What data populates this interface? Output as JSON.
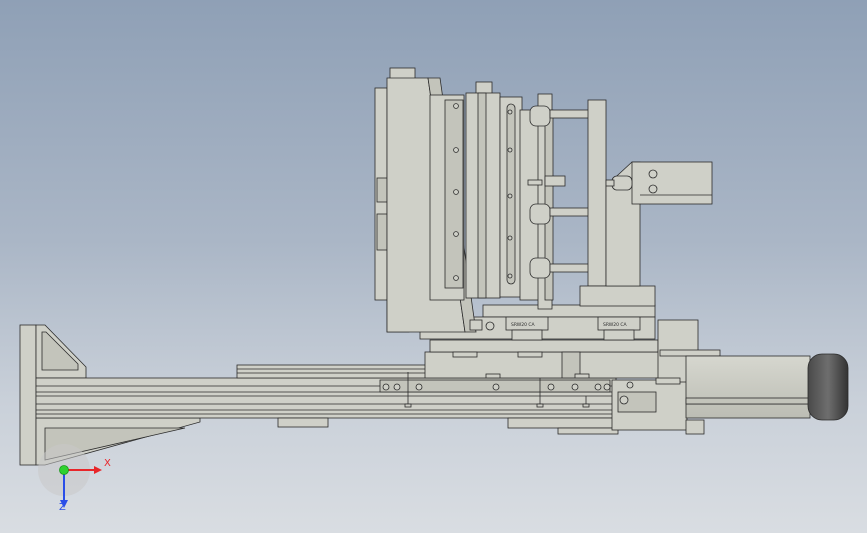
{
  "viewport": {
    "background_top": "#8fa0b6",
    "background_bottom": "#d9dde2",
    "part_fill": "#cfd0c8",
    "part_shade": "#b8b9b0",
    "edge_color": "#2b2b2b"
  },
  "triad": {
    "x_label": "X",
    "z_label": "Z",
    "x_color": "#e8262a",
    "y_color": "#2fd12f",
    "z_color": "#2a4ee8"
  },
  "guide_labels": {
    "carriage_left": "SRW20 CA",
    "carriage_right": "SRW20 CA"
  }
}
